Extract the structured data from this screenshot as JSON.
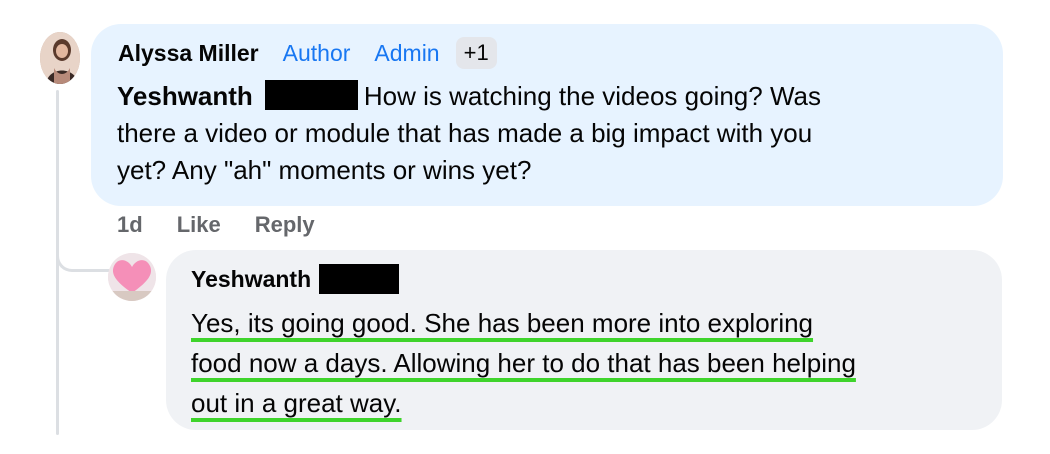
{
  "top_comment": {
    "author": "Alyssa Miller",
    "badges": [
      "Author",
      "Admin"
    ],
    "badge_extra": "+1",
    "mention": "Yeshwanth",
    "text": "How is watching the videos going? Was there a video or module that has made a big impact with you yet? Any \"ah\" moments or wins yet?",
    "line1": "How is watching the videos going? Was",
    "line2": "there a video or module that has made a big impact with you",
    "line3": "yet? Any \"ah\" moments or wins yet?"
  },
  "actions": {
    "time": "1d",
    "like": "Like",
    "reply": "Reply"
  },
  "reply_comment": {
    "author": "Yeshwanth",
    "line1": "Yes, its going good. She has been more into exploring",
    "line2": "food now a days. Allowing her to do that has been helping",
    "line3": "out in a great way."
  },
  "colors": {
    "top_bubble": "#e7f3ff",
    "reply_bubble": "#f0f2f5",
    "badge_blue": "#1877f2",
    "highlight_green": "#3fd42c",
    "action_gray": "#65676b"
  },
  "icons": {
    "top_avatar": "profile-photo-icon",
    "reply_avatar": "heart-avatar-icon"
  }
}
